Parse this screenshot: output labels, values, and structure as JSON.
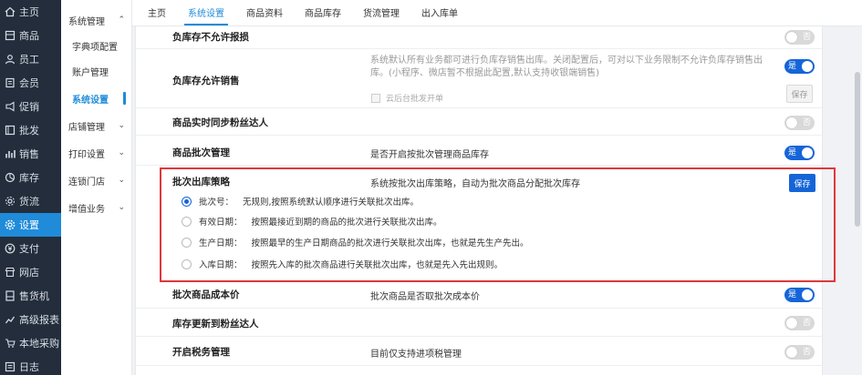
{
  "nav": [
    {
      "label": "主页",
      "icon": "home-icon"
    },
    {
      "label": "商品",
      "icon": "product-icon"
    },
    {
      "label": "员工",
      "icon": "staff-icon"
    },
    {
      "label": "会员",
      "icon": "member-icon"
    },
    {
      "label": "促销",
      "icon": "promo-icon"
    },
    {
      "label": "批发",
      "icon": "wholesale-icon"
    },
    {
      "label": "销售",
      "icon": "sales-chart-icon"
    },
    {
      "label": "库存",
      "icon": "inventory-icon"
    },
    {
      "label": "货流",
      "icon": "goods-flow-icon"
    },
    {
      "label": "设置",
      "icon": "gear-icon"
    },
    {
      "label": "支付",
      "icon": "payment-icon"
    },
    {
      "label": "网店",
      "icon": "store-icon"
    },
    {
      "label": "售货机",
      "icon": "vending-icon"
    },
    {
      "label": "高级报表",
      "icon": "report-icon"
    },
    {
      "label": "本地采购",
      "icon": "purchase-icon"
    },
    {
      "label": "日志",
      "icon": "log-icon"
    }
  ],
  "submenu": {
    "system": "系统管理",
    "dict": "字典项配置",
    "account": "账户管理",
    "settings": "系统设置",
    "store": "店铺管理",
    "print": "打印设置",
    "chain": "连锁门店",
    "value_added": "增值业务"
  },
  "tabs": [
    "主页",
    "系统设置",
    "商品资料",
    "商品库存",
    "货流管理",
    "出入库单"
  ],
  "rows": {
    "neg_not_allowed": {
      "label": "负库存不允许报损",
      "toggle": "否"
    },
    "neg_allowed": {
      "label": "负库存允许销售",
      "desc": "系统默认所有业务都可进行负库存销售出库。关闭配置后，可对以下业务限制不允许负库存销售出库。(小程序、微店暂不根据此配置,默认支持收银端销售)",
      "toggle": "是",
      "checkbox": "云后台批发开单",
      "save": "保存"
    },
    "sync_fans": {
      "label": "商品实时同步粉丝达人",
      "toggle": "否"
    },
    "batch_mgmt": {
      "label": "商品批次管理",
      "desc": "是否开启按批次管理商品库存",
      "toggle": "是"
    },
    "batch_strategy": {
      "label": "批次出库策略",
      "desc": "系统按批次出库策略，自动为批次商品分配批次库存",
      "save": "保存",
      "options": [
        {
          "name": "批次号：",
          "desc": "无规则,按照系统默认顺序进行关联批次出库。",
          "selected": true
        },
        {
          "name": "有效日期：",
          "desc": "按照最接近到期的商品的批次进行关联批次出库。",
          "selected": false
        },
        {
          "name": "生产日期：",
          "desc": "按照最早的生产日期商品的批次进行关联批次出库，也就是先生产先出。",
          "selected": false
        },
        {
          "name": "入库日期：",
          "desc": "按照先入库的批次商品进行关联批次出库，也就是先入先出规则。",
          "selected": false
        }
      ]
    },
    "batch_cost": {
      "label": "批次商品成本价",
      "desc": "批次商品是否取批次成本价",
      "toggle": "是"
    },
    "stock_fans": {
      "label": "库存更新到粉丝达人",
      "toggle": "否"
    },
    "tax": {
      "label": "开启税务管理",
      "desc": "目前仅支持进项税管理",
      "toggle": "否"
    }
  },
  "colors": {
    "accent": "#1f8bd9",
    "toggle_on": "#1565d8",
    "highlight_border": "#e0373b",
    "sidebar": "#232d3b"
  }
}
